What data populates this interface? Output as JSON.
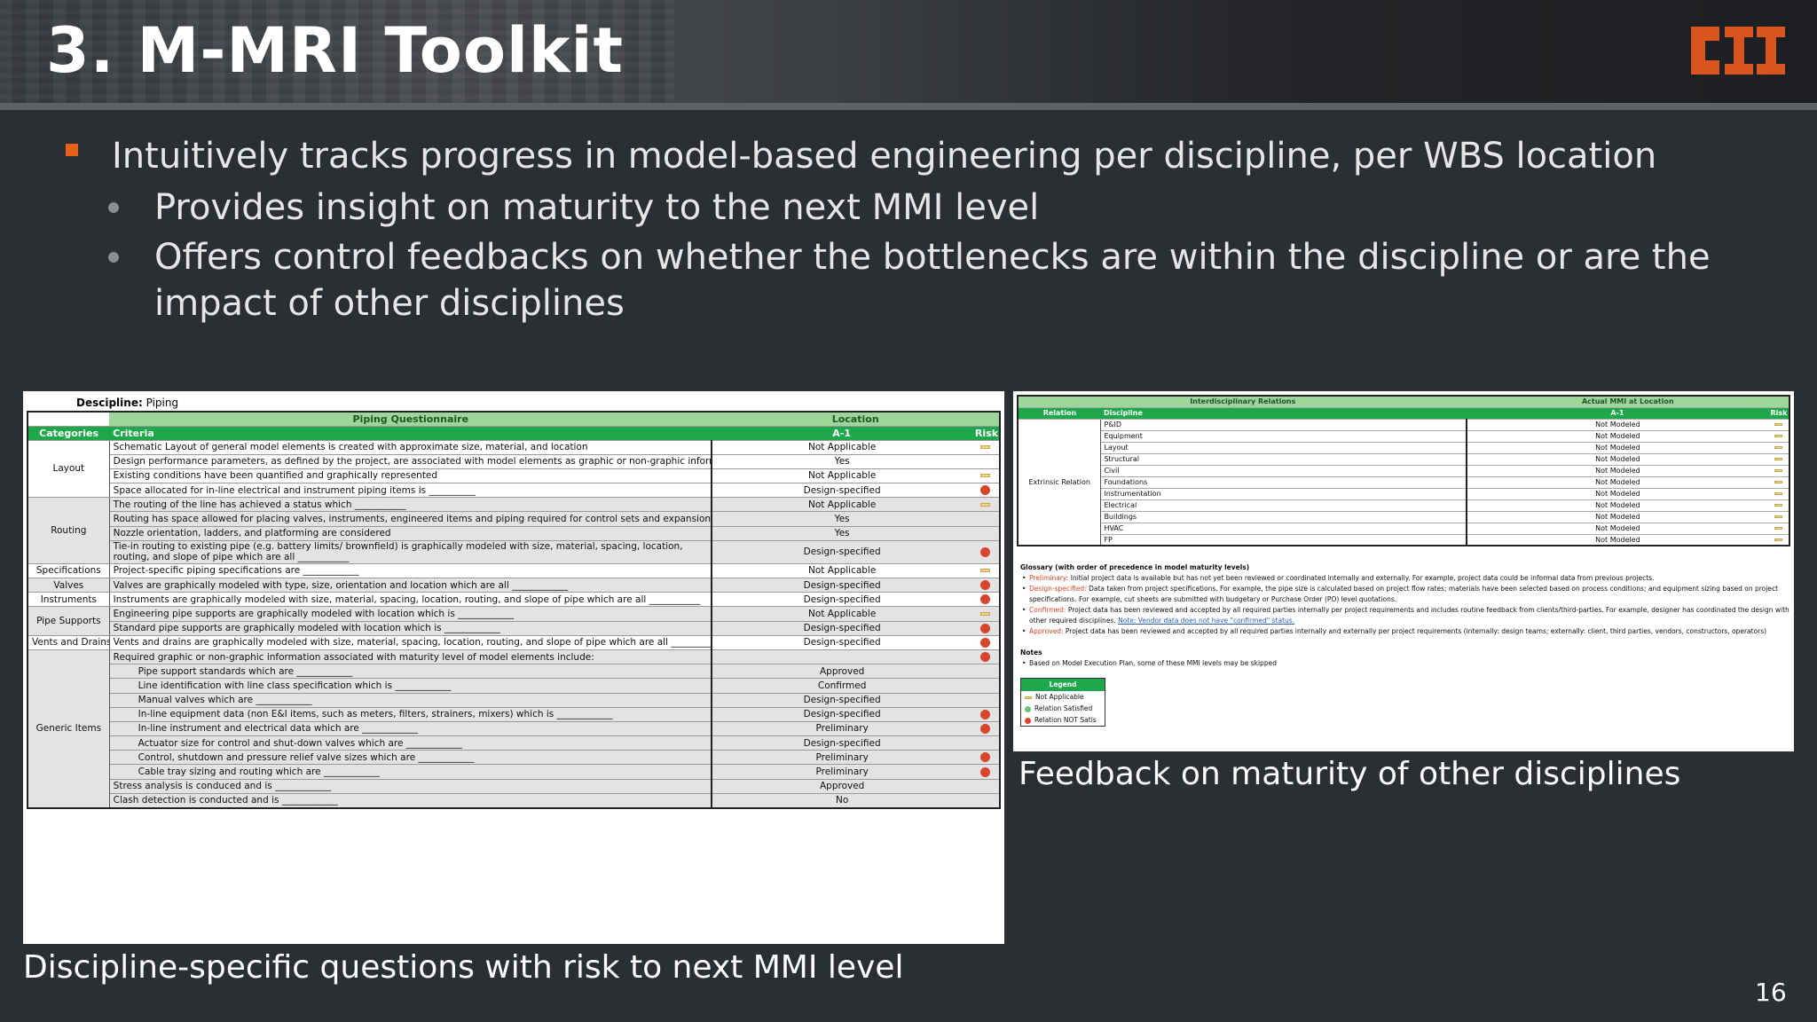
{
  "slide": {
    "title": "3. M-MRI Toolkit",
    "logo_text": "CII",
    "page_number": "16",
    "bullets": {
      "main": "Intuitively tracks progress in model-based engineering per discipline, per WBS location",
      "sub": [
        "Provides insight on maturity to the next MMI level",
        "Offers control feedbacks on whether the bottlenecks are within the discipline or are the impact of other disciplines"
      ]
    },
    "caption_left": "Discipline-specific questions with risk to next MMI level",
    "caption_right": "Feedback on maturity of other disciplines"
  },
  "questionnaire": {
    "discipline_label": "Descipline:",
    "discipline_value": "Piping",
    "header_title": "Piping Questionnaire",
    "header_location": "Location",
    "col_categories": "Categories",
    "col_criteria": "Criteria",
    "col_location": "A-1",
    "col_risk": "Risk",
    "rows": [
      {
        "cat": "Layout",
        "criteria": "Schematic Layout of general model elements is created with approximate size, material, and location",
        "loc": "Not Applicable",
        "risk": "dash"
      },
      {
        "cat": "",
        "criteria": "Design performance parameters, as defined by the project, are associated with model elements as graphic or non-graphic information",
        "loc": "Yes",
        "risk": ""
      },
      {
        "cat": "",
        "criteria": "Existing conditions have been quantified and graphically represented",
        "loc": "Not Applicable",
        "risk": "dash"
      },
      {
        "cat": "",
        "criteria": "Space allocated for in-line electrical and instrument piping items is __________",
        "loc": "Design-specified",
        "risk": "dot"
      },
      {
        "cat": "Routing",
        "criteria": "The routing of the line has achieved a status which ___________",
        "loc": "Not Applicable",
        "risk": "dash"
      },
      {
        "cat": "",
        "criteria": "Routing has space allowed for placing valves, instruments, engineered items and piping required for control sets and expansion loops",
        "loc": "Yes",
        "risk": ""
      },
      {
        "cat": "",
        "criteria": "Nozzle orientation, ladders, and platforming are considered",
        "loc": "Yes",
        "risk": ""
      },
      {
        "cat": "",
        "criteria": "Tie-in routing to existing pipe (e.g. battery limits/ brownfield) is graphically modeled with size, material, spacing, location, routing, and slope of pipe which are all ___________",
        "loc": "Design-specified",
        "risk": "dot"
      },
      {
        "cat": "Specifications",
        "criteria": "Project-specific piping specifications are ____________",
        "loc": "Not Applicable",
        "risk": "dash"
      },
      {
        "cat": "Valves",
        "criteria": "Valves are graphically modeled with type, size, orientation and location which are all ____________",
        "loc": "Design-specified",
        "risk": "dot"
      },
      {
        "cat": "Instruments",
        "criteria": "Instruments are graphically modeled with size, material, spacing, location, routing, and slope of pipe which are all ___________",
        "loc": "Design-specified",
        "risk": "dot"
      },
      {
        "cat": "Pipe Supports",
        "criteria": "Engineering pipe supports are graphically modeled with location which is ____________",
        "loc": "Not Applicable",
        "risk": "dash"
      },
      {
        "cat": "",
        "criteria": "Standard pipe supports are graphically modeled with location which is ____________",
        "loc": "Design-specified",
        "risk": "dot"
      },
      {
        "cat": "Vents and Drains",
        "criteria": "Vents and drains are graphically modeled with size, material, spacing, location, routing, and slope of pipe which are all ____________",
        "loc": "Design-specified",
        "risk": "dot"
      },
      {
        "cat": "Generic Items",
        "criteria": "Required graphic or non-graphic information associated with maturity level of model elements include:",
        "loc": "",
        "risk": "dot"
      },
      {
        "cat": "",
        "criteria": "Pipe support standards which are ____________",
        "loc": "Approved",
        "risk": ""
      },
      {
        "cat": "",
        "criteria": "Line identification with line class specification which is ____________",
        "loc": "Confirmed",
        "risk": ""
      },
      {
        "cat": "",
        "criteria": "Manual valves which are ____________",
        "loc": "Design-specified",
        "risk": ""
      },
      {
        "cat": "",
        "criteria": "In-line equipment data (non E&I items, such as meters, filters, strainers, mixers) which is ____________",
        "loc": "Design-specified",
        "risk": "dot"
      },
      {
        "cat": "",
        "criteria": "In-line instrument and electrical data which are ____________",
        "loc": "Preliminary",
        "risk": "dot"
      },
      {
        "cat": "",
        "criteria": "Actuator size for control and shut-down valves which are ____________",
        "loc": "Design-specified",
        "risk": ""
      },
      {
        "cat": "",
        "criteria": "Control, shutdown and pressure relief valve sizes which are ____________",
        "loc": "Preliminary",
        "risk": "dot"
      },
      {
        "cat": "",
        "criteria": "Cable tray sizing and routing which are ____________",
        "loc": "Preliminary",
        "risk": "dot"
      },
      {
        "cat": "",
        "criteria": "Stress analysis  is conduced and is ____________",
        "loc": "Approved",
        "risk": ""
      },
      {
        "cat": "",
        "criteria": "Clash detection is conducted and is ____________",
        "loc": "No",
        "risk": ""
      }
    ]
  },
  "relations": {
    "header_title": "Interdisciplinary Relations",
    "header_actual": "Actual MMI at Location",
    "col_relation": "Relation",
    "col_discipline": "Discipline",
    "col_location": "A-1",
    "col_risk": "Risk",
    "relation_label": "Extrinsic Relation",
    "rows": [
      {
        "discipline": "P&ID",
        "actual": "Not Modeled"
      },
      {
        "discipline": "Equipment",
        "actual": "Not Modeled"
      },
      {
        "discipline": "Layout",
        "actual": "Not Modeled"
      },
      {
        "discipline": "Structural",
        "actual": "Not Modeled"
      },
      {
        "discipline": "Civil",
        "actual": "Not Modeled"
      },
      {
        "discipline": "Foundations",
        "actual": "Not Modeled"
      },
      {
        "discipline": "Instrumentation",
        "actual": "Not Modeled"
      },
      {
        "discipline": "Electrical",
        "actual": "Not Modeled"
      },
      {
        "discipline": "Buildings",
        "actual": "Not Modeled"
      },
      {
        "discipline": "HVAC",
        "actual": "Not Modeled"
      },
      {
        "discipline": "FP",
        "actual": "Not Modeled"
      }
    ],
    "glossary_title": "Glossary (with order of precedence in model maturity levels)",
    "glossary": [
      {
        "term": "Preliminary:",
        "text": "Initial project data is available but has not yet been reviewed or coordinated internally and externally. For example, project data could be informal data from previous projects."
      },
      {
        "term": "Design-specified:",
        "text": "Data taken from project specifications. For example, the pipe size is calculated based on project flow rates; materials have been selected based on process conditions; and equipment sizing based on project specifications. For example, cut sheets are submitted with budgetary or Purchase Order (PO) level quotations."
      },
      {
        "term": "Confirmed:",
        "text": "Project data has been reviewed and accepted by all required parties internally per project requirements and includes routine feedback from clients/third-parties. For example, designer has coordinated the design with other required disciplines.",
        "note": "Note: Vendor data does not have \"confirmed\" status."
      },
      {
        "term": "Approved:",
        "text": "Project data has been reviewed and accepted by all required parties internally and externally per project requirements (internally: design teams; externally: client, third parties, vendors, constructors, operators)"
      }
    ],
    "notes_title": "Notes",
    "notes": [
      "Based on Model Execution Plan, some of these MMI levels may be skipped"
    ],
    "legend_title": "Legend",
    "legend": [
      "Not Applicable",
      "Relation Satisfied",
      "Relation NOT Satis"
    ]
  }
}
